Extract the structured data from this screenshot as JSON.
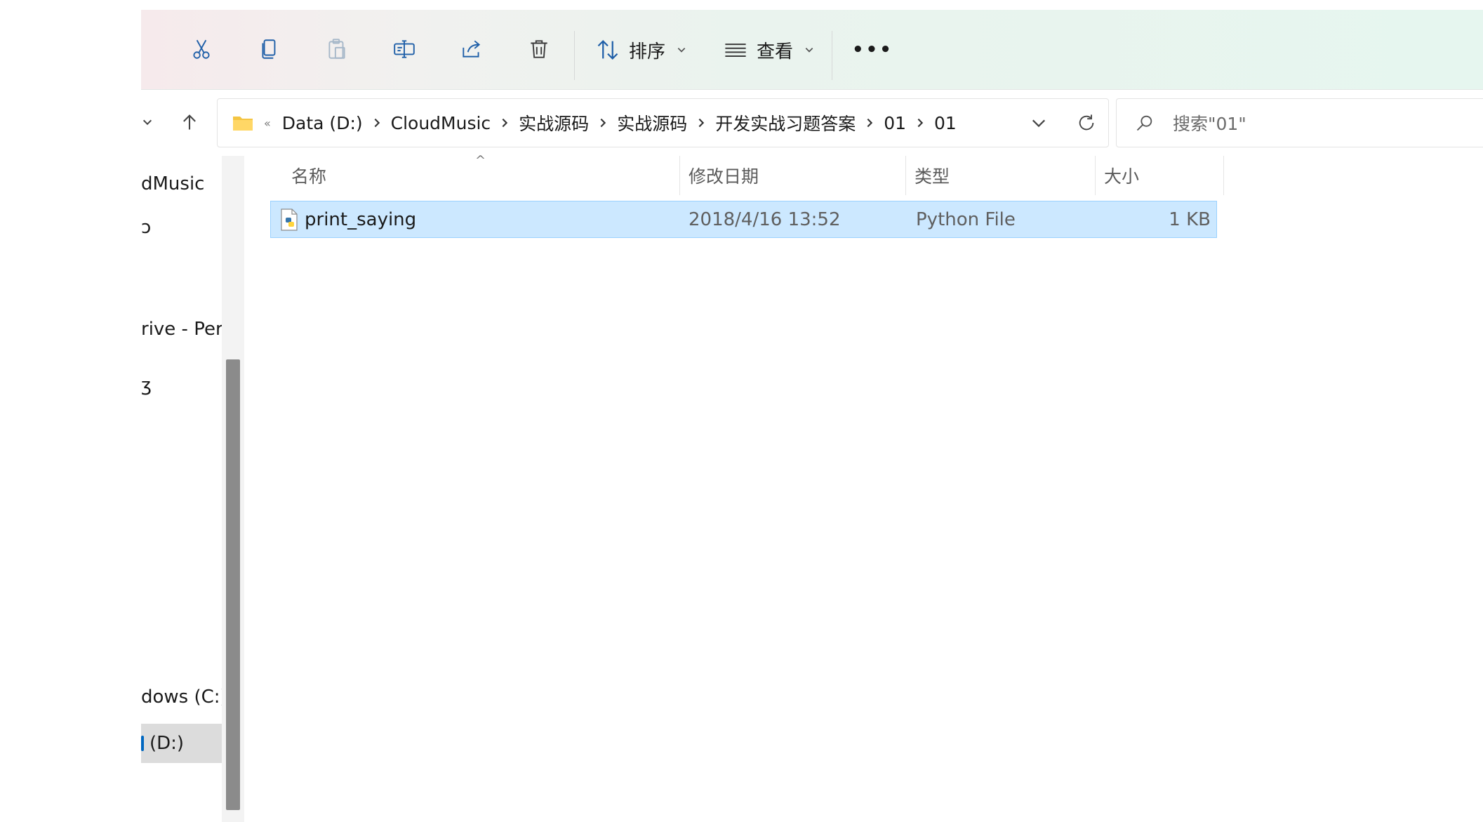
{
  "toolbar": {
    "buttons": [
      {
        "name": "cut",
        "icon": "scissors-icon"
      },
      {
        "name": "copy",
        "icon": "copy-icon"
      },
      {
        "name": "paste",
        "icon": "paste-icon"
      },
      {
        "name": "rename",
        "icon": "rename-icon"
      },
      {
        "name": "share",
        "icon": "share-icon"
      },
      {
        "name": "delete",
        "icon": "trash-icon"
      }
    ],
    "sort_label": "排序",
    "view_label": "查看",
    "more_label": "•••"
  },
  "address_bar": {
    "overflow_glyph": "«",
    "crumbs": [
      "Data (D:)",
      "CloudMusic",
      "实战源码",
      "实战源码",
      "开发实战习题答案",
      "01",
      "01"
    ]
  },
  "search": {
    "placeholder": "搜索\"01\""
  },
  "nav_pane": {
    "items": [
      {
        "label": "dMusic"
      },
      {
        "label": "ɔ"
      },
      {
        "label": "rive - Pers"
      },
      {
        "label": "ʒ"
      },
      {
        "label": "dows (C:)"
      },
      {
        "label": "(D:)",
        "active": true
      }
    ]
  },
  "file_list": {
    "sort_indicator": "^",
    "columns": [
      "名称",
      "修改日期",
      "类型",
      "大小"
    ],
    "rows": [
      {
        "name": "print_saying",
        "modified": "2018/4/16 13:52",
        "type": "Python File",
        "size": "1 KB",
        "icon": "python-file-icon",
        "selected": true
      }
    ]
  },
  "colors": {
    "selection_bg": "#cce8ff",
    "selection_border": "#99d1ff",
    "accent": "#0067c0",
    "folder": "#f4c542"
  }
}
